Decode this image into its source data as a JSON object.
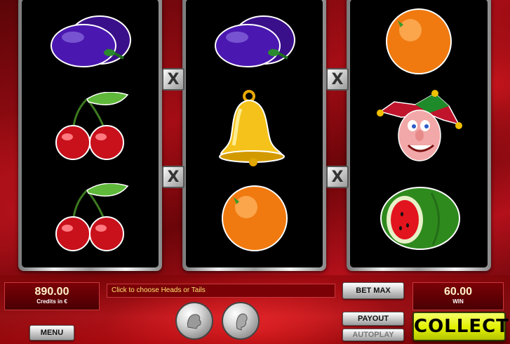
{
  "reels": [
    {
      "symbols": [
        "plum",
        "cherries",
        "cherries"
      ]
    },
    {
      "symbols": [
        "plum",
        "bell",
        "orange"
      ]
    },
    {
      "symbols": [
        "orange",
        "jester",
        "watermelon"
      ]
    }
  ],
  "payline_markers": [
    {
      "side": "left",
      "glyph": "X"
    },
    {
      "side": "left",
      "glyph": "X"
    },
    {
      "side": "right",
      "glyph": "X"
    },
    {
      "side": "right",
      "glyph": "X"
    }
  ],
  "credits": {
    "value": "890.00",
    "caption": "Credits in €"
  },
  "message": "Click to choose Heads or Tails",
  "win": {
    "value": "60.00",
    "caption": "WIN"
  },
  "buttons": {
    "bet_max": "BET MAX",
    "payout": "PAYOUT",
    "autoplay": "AUTOPLAY",
    "menu": "MENU",
    "collect": "COLLECT"
  },
  "gamble": {
    "heads_icon": "head-coin-icon",
    "tails_icon": "tails-coin-icon"
  },
  "colors": {
    "collect": "#e2f000",
    "display_bg": "#7a0106",
    "message_text": "#ffe36e"
  }
}
